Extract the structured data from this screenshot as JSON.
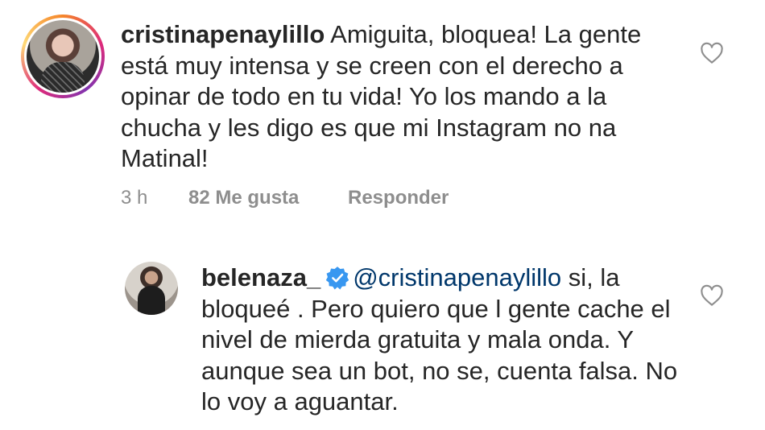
{
  "comments": [
    {
      "username": "cristinapenaylillo",
      "text": " Amiguita, bloquea! La gente está muy intensa y se creen con el derecho a opinar de todo en tu vida! Yo los mando a la chucha y les digo es que mi Instagram no na Matinal!",
      "time": "3 h",
      "likes": "82 Me gusta",
      "reply": "Responder",
      "avatar_icon": "profile-avatar",
      "like_icon": "heart-outline-icon"
    },
    {
      "username": "belenaza_",
      "verified": true,
      "mention": "@cristinapenaylillo",
      "text": " si, la bloqueé . Pero quiero que l gente cache el nivel de mierda gratuita y mala onda. Y aunque sea un bot, no se, cuenta falsa. No lo voy a aguantar.",
      "avatar_icon": "profile-avatar",
      "like_icon": "heart-outline-icon"
    }
  ],
  "colors": {
    "text": "#262626",
    "muted": "#8e8e8e",
    "mention": "#00376b",
    "verified": "#3897f0"
  }
}
